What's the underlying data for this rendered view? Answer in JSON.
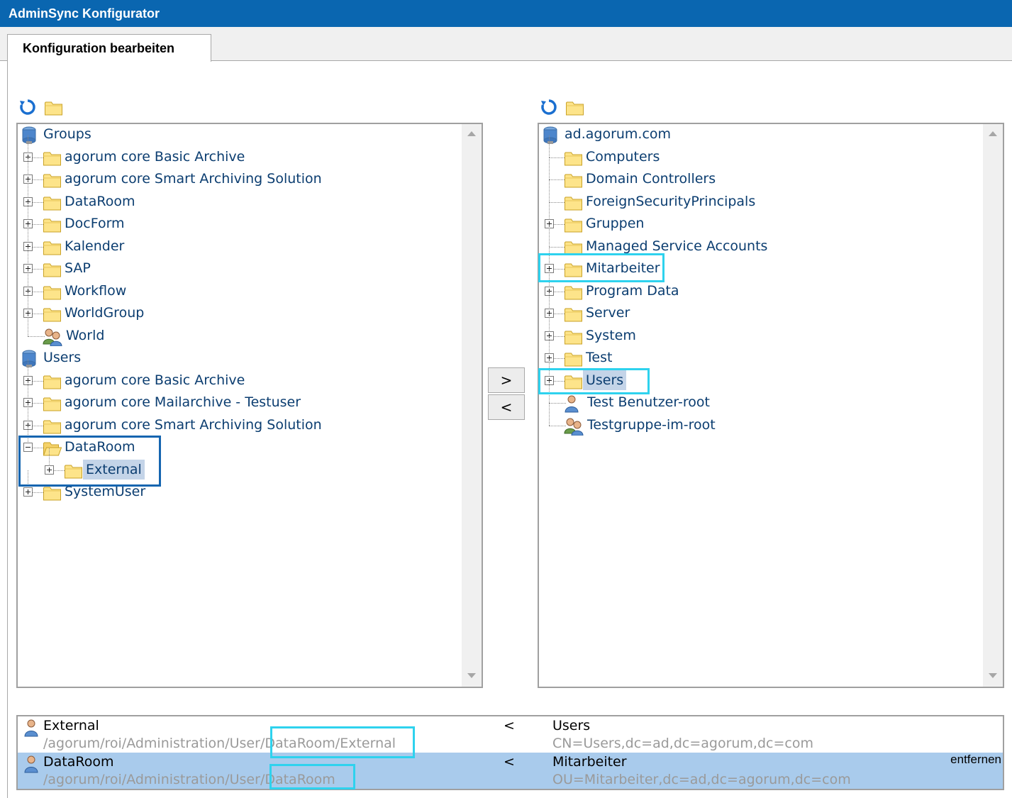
{
  "window": {
    "title": "AdminSync Konfigurator"
  },
  "tabs": [
    {
      "label": "Konfiguration bearbeiten",
      "active": true
    }
  ],
  "left_tree": {
    "toolbar": [
      "refresh-icon",
      "folder-icon"
    ],
    "nodes": [
      {
        "label": "Groups",
        "level": 0,
        "icon": "directory-icon",
        "expander": "none"
      },
      {
        "label": "agorum core Basic Archive",
        "level": 1,
        "icon": "folder-icon",
        "expander": "plus"
      },
      {
        "label": "agorum core Smart Archiving Solution",
        "level": 1,
        "icon": "folder-icon",
        "expander": "plus"
      },
      {
        "label": "DataRoom",
        "level": 1,
        "icon": "folder-icon",
        "expander": "plus"
      },
      {
        "label": "DocForm",
        "level": 1,
        "icon": "folder-icon",
        "expander": "plus"
      },
      {
        "label": "Kalender",
        "level": 1,
        "icon": "folder-icon",
        "expander": "plus"
      },
      {
        "label": "SAP",
        "level": 1,
        "icon": "folder-icon",
        "expander": "plus"
      },
      {
        "label": "Workflow",
        "level": 1,
        "icon": "folder-icon",
        "expander": "plus"
      },
      {
        "label": "WorldGroup",
        "level": 1,
        "icon": "folder-icon",
        "expander": "plus"
      },
      {
        "label": "World",
        "level": 1,
        "icon": "group-icon",
        "expander": "none"
      },
      {
        "label": "Users",
        "level": 0,
        "icon": "directory-icon",
        "expander": "none"
      },
      {
        "label": "agorum core Basic Archive",
        "level": 1,
        "icon": "folder-icon",
        "expander": "plus"
      },
      {
        "label": "agorum core Mailarchive - Testuser",
        "level": 1,
        "icon": "folder-icon",
        "expander": "plus"
      },
      {
        "label": "agorum core Smart Archiving Solution",
        "level": 1,
        "icon": "folder-icon",
        "expander": "plus"
      },
      {
        "label": "DataRoom",
        "level": 1,
        "icon": "folder-open-icon",
        "expander": "minus"
      },
      {
        "label": "External",
        "level": 2,
        "icon": "folder-icon",
        "expander": "plus",
        "selected": true
      },
      {
        "label": "SystemUser",
        "level": 1,
        "icon": "folder-icon",
        "expander": "plus"
      }
    ]
  },
  "right_tree": {
    "toolbar": [
      "refresh-icon",
      "folder-icon"
    ],
    "nodes": [
      {
        "label": "ad.agorum.com",
        "level": 0,
        "icon": "directory-icon",
        "expander": "none"
      },
      {
        "label": "Computers",
        "level": 1,
        "icon": "folder-icon",
        "expander": "none"
      },
      {
        "label": "Domain Controllers",
        "level": 1,
        "icon": "folder-icon",
        "expander": "none"
      },
      {
        "label": "ForeignSecurityPrincipals",
        "level": 1,
        "icon": "folder-icon",
        "expander": "none"
      },
      {
        "label": "Gruppen",
        "level": 1,
        "icon": "folder-icon",
        "expander": "plus"
      },
      {
        "label": "Managed Service Accounts",
        "level": 1,
        "icon": "folder-icon",
        "expander": "none"
      },
      {
        "label": "Mitarbeiter",
        "level": 1,
        "icon": "folder-icon",
        "expander": "plus"
      },
      {
        "label": "Program Data",
        "level": 1,
        "icon": "folder-icon",
        "expander": "plus"
      },
      {
        "label": "Server",
        "level": 1,
        "icon": "folder-icon",
        "expander": "plus"
      },
      {
        "label": "System",
        "level": 1,
        "icon": "folder-icon",
        "expander": "plus"
      },
      {
        "label": "Test",
        "level": 1,
        "icon": "folder-icon",
        "expander": "plus"
      },
      {
        "label": "Users",
        "level": 1,
        "icon": "folder-icon",
        "expander": "plus",
        "selected": true
      },
      {
        "label": "Test Benutzer-root",
        "level": 1,
        "icon": "user-icon",
        "expander": "none"
      },
      {
        "label": "Testgruppe-im-root",
        "level": 1,
        "icon": "group-icon",
        "expander": "none"
      }
    ]
  },
  "transfer_buttons": {
    "add": ">",
    "remove": "<"
  },
  "mappings": [
    {
      "name": "External",
      "path": "/agorum/roi/Administration/User/DataRoom/External",
      "path_prefix": "/agorum/roi/Administration/User",
      "path_suffix": "/DataRoom/External",
      "direction": "<",
      "target": "Users",
      "dn": "CN=Users,dc=ad,dc=agorum,dc=com",
      "selected": false
    },
    {
      "name": "DataRoom",
      "path": "/agorum/roi/Administration/User/DataRoom",
      "path_prefix": "/agorum/roi/Administration/User",
      "path_suffix": "/DataRoom",
      "direction": "<",
      "target": "Mitarbeiter",
      "dn": "OU=Mitarbeiter,dc=ad,dc=agorum,dc=com",
      "selected": true,
      "remove_label": "entfernen"
    }
  ],
  "colors": {
    "titlebar": "#0a66b0",
    "highlight_blue": "#1565b0",
    "highlight_cyan": "#2ed2ee",
    "selected_row": "#a9cbec",
    "tree_text": "#0b3d70"
  }
}
